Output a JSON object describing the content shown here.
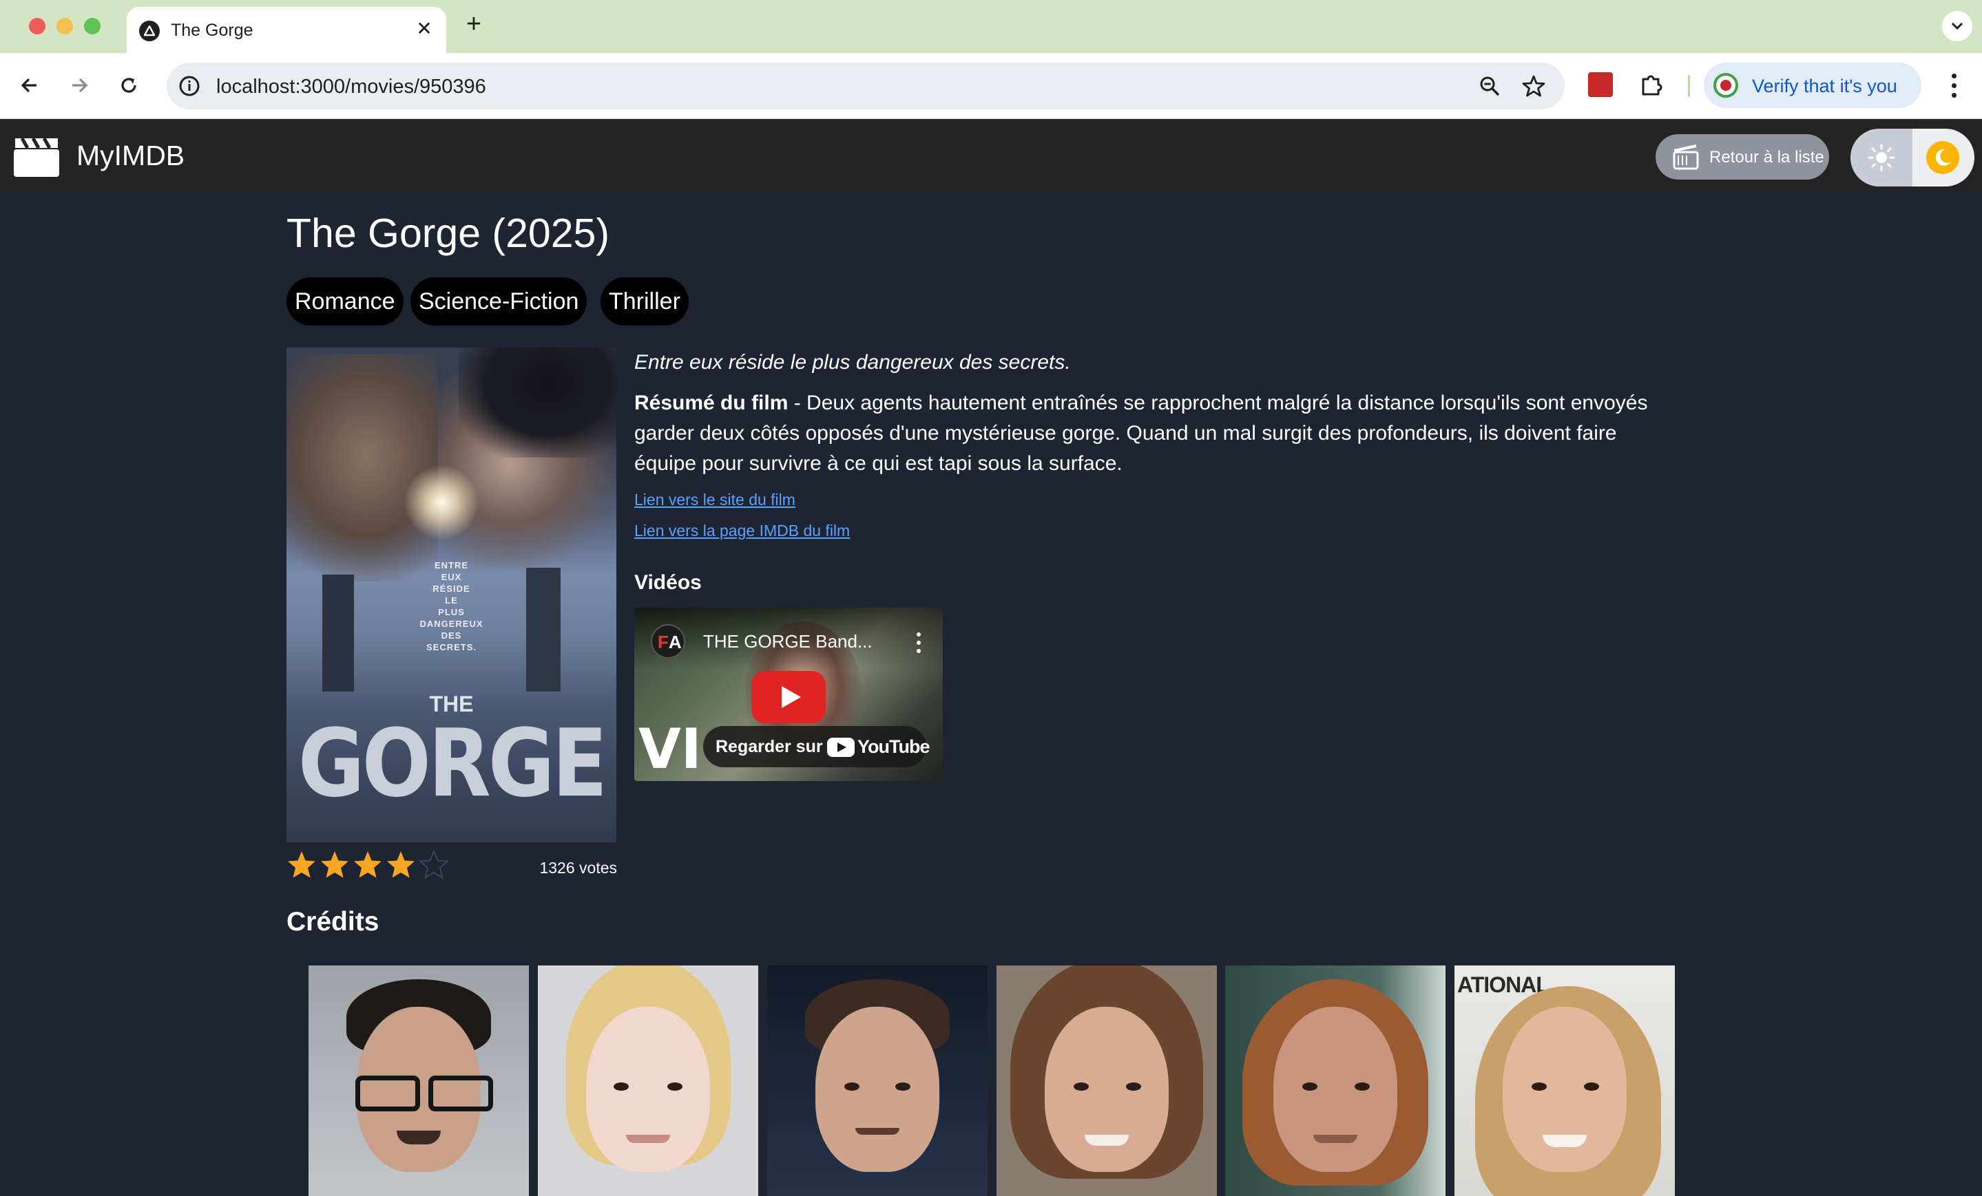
{
  "browser": {
    "tab_title": "The Gorge",
    "url": "localhost:3000/movies/950396",
    "verify_label": "Verify that it's you"
  },
  "app": {
    "name": "MyIMDB",
    "back_label": "Retour à la liste"
  },
  "movie": {
    "title": "The Gorge (2025)",
    "genres": [
      "Romance",
      "Science-Fiction",
      "Thriller"
    ],
    "tagline": "Entre eux réside le plus dangereux des secrets.",
    "summary_label": "Résumé du film",
    "summary_text": " - Deux agents hautement entraînés se rapprochent malgré la distance lorsqu'ils sont envoyés garder deux côtés opposés d'une mystérieuse gorge. Quand un mal surgit des profondeurs, ils doivent faire équipe pour survivre à ce qui est tapi sous la surface.",
    "site_link": "Lien vers le site du film",
    "imdb_link": "Lien vers la page IMDB du film",
    "rating_stars": 4,
    "rating_max": 5,
    "votes": "1326 votes",
    "poster": {
      "tagline_lines": [
        "ENTRE",
        "EUX",
        "RÉSIDE",
        "LE",
        "PLUS",
        "DANGEREUX",
        "DES",
        "SECRETS."
      ],
      "the": "THE",
      "gorge": "GORGE"
    }
  },
  "videos": {
    "heading": "Vidéos",
    "items": [
      {
        "title": "THE GORGE Band...",
        "channel_badge": "A",
        "overlay_text": "VI",
        "watch_label": "Regarder sur",
        "platform": "YouTube"
      }
    ]
  },
  "credits": {
    "heading": "Crédits",
    "p5_text": "ATIONAL"
  },
  "colors": {
    "page_bg": "#1f2433",
    "header_bg": "#242424",
    "link": "#5aa0ff",
    "star": "#f5a623",
    "genre_chip_bg": "#000000",
    "play_button": "#e02323"
  }
}
